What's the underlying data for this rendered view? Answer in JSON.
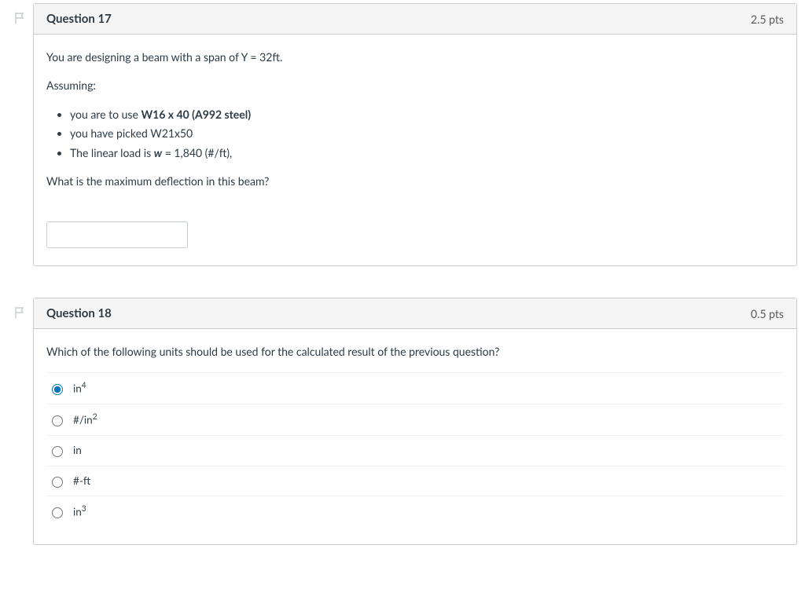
{
  "q17": {
    "title": "Question 17",
    "points": "2.5 pts",
    "intro": "You are designing a beam with a span of Y = 32ft.",
    "assuming_label": "Assuming:",
    "bullet1_pre": "you are to use ",
    "bullet1_bold": "W16 x 40 (A992 steel)",
    "bullet2": "you have picked W21x50",
    "bullet3_pre": "The linear load is ",
    "bullet3_boldital": "w",
    "bullet3_post": " = 1,840 (#/ft),",
    "prompt": "What is the maximum deflection in this beam?",
    "answer_value": ""
  },
  "q18": {
    "title": "Question 18",
    "points": "0.5 pts",
    "prompt": "Which of the following units should be used for the calculated result of the previous question?",
    "selected_index": 0,
    "options": [
      {
        "html": "in<sup class='sup'>4</sup>"
      },
      {
        "html": "#/in<sup class='sup'>2</sup>"
      },
      {
        "html": "in"
      },
      {
        "html": "#-ft"
      },
      {
        "html": "in<sup class='sup'>3</sup>"
      }
    ]
  }
}
